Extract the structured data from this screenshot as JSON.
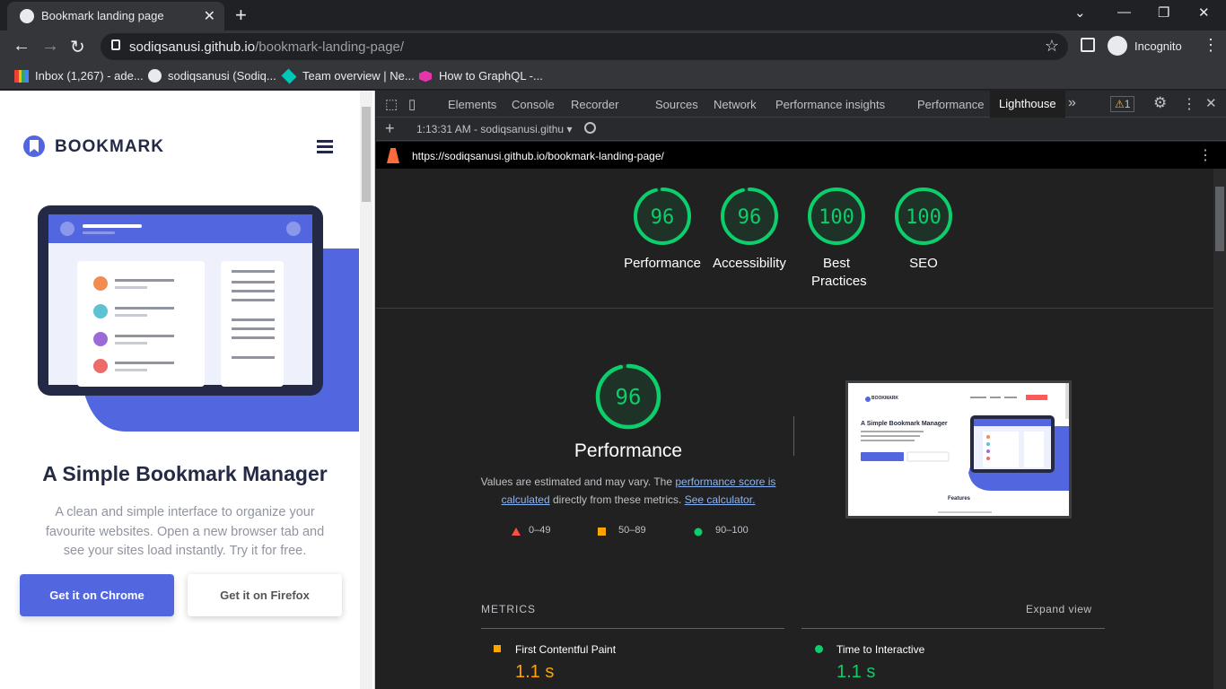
{
  "browser": {
    "tab_title": "Bookmark landing page",
    "url_host": "sodiqsanusi.github.io",
    "url_path": "/bookmark-landing-page/",
    "incognito_label": "Incognito",
    "bookmarks": [
      {
        "label": "Inbox (1,267) - ade..."
      },
      {
        "label": "sodiqsanusi (Sodiq..."
      },
      {
        "label": "Team overview | Ne..."
      },
      {
        "label": "How to GraphQL -..."
      }
    ]
  },
  "site": {
    "logo": "BOOKMARK",
    "hero_title": "A Simple Bookmark Manager",
    "hero_text": "A clean and simple interface to organize your favourite websites. Open a new browser tab and see your sites load instantly. Try it for free.",
    "btn_chrome": "Get it on Chrome",
    "btn_firefox": "Get it on Firefox"
  },
  "devtools": {
    "tabs": [
      "Elements",
      "Console",
      "Recorder",
      "Sources",
      "Network",
      "Performance insights",
      "Performance",
      "Lighthouse"
    ],
    "warning_count": "1",
    "report_time": "1:13:31 AM - sodiqsanusi.githu",
    "report_url": "https://sodiqsanusi.github.io/bookmark-landing-page/",
    "scores": [
      {
        "value": "96",
        "label": "Performance"
      },
      {
        "value": "96",
        "label": "Accessibility"
      },
      {
        "value": "100",
        "label": "Best Practices"
      },
      {
        "value": "100",
        "label": "SEO"
      }
    ],
    "perf": {
      "score": "96",
      "title": "Performance",
      "desc_1": "Values are estimated and may vary. The ",
      "link_1": "performance score is calculated",
      "desc_2": " directly from these metrics. ",
      "link_2": "See calculator.",
      "legend": [
        {
          "range": "0–49",
          "color": "#ff4e42"
        },
        {
          "range": "50–89",
          "color": "#ffa400"
        },
        {
          "range": "90–100",
          "color": "#0cce6b"
        }
      ]
    },
    "metrics_label": "METRICS",
    "expand_label": "Expand view",
    "metrics": [
      {
        "name": "First Contentful Paint",
        "value": "1.1 s",
        "color": "#ffa400"
      },
      {
        "name": "Time to Interactive",
        "value": "1.1 s",
        "color": "#0cce6b"
      }
    ],
    "thumb": {
      "logo": "BOOKMARK",
      "title": "A Simple Bookmark Manager",
      "features": "Features"
    }
  },
  "colors": {
    "green": "#0cce6b",
    "orange": "#ffa400",
    "red": "#ff4e42",
    "brand": "#5267df",
    "brand_red": "#fa5959"
  }
}
